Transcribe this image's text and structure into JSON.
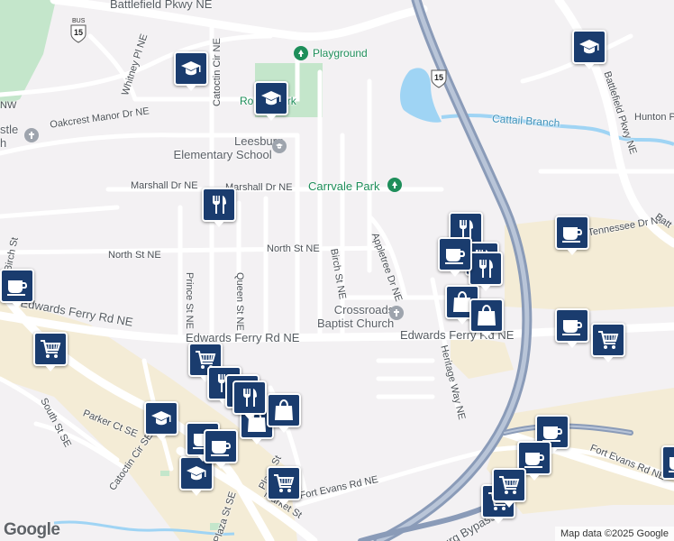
{
  "map": {
    "streets": {
      "battlefield_pkwy_top": "Battlefield Pkwy NE",
      "whitney": "Whitney Pl NE",
      "catoctin_top": "Catoctin Cir NE",
      "oakcrest": "Oakcrest Manor Dr NE",
      "marshall_left": "Marshall Dr NE",
      "marshall_right": "Marshall Dr NE",
      "north_left": "North St NE",
      "north_right": "North St NE",
      "birch": "Birch St NE",
      "appletree": "Appletree Dr NE",
      "prince": "Prince St NE",
      "queen": "Queen St NE",
      "edwards_left": "Edwards Ferry Rd NE",
      "edwards_center": "Edwards Ferry Rd NE",
      "edwards_right": "Edwards Ferry Rd NE",
      "heritage": "Heritage Way NE",
      "south": "South St SE",
      "parker": "Parker Ct SE",
      "catoctin_se": "Catoctin Cir SE",
      "plaza": "Plaza St",
      "plaza_se": "Plaza St SE",
      "market": "Market St",
      "fort_evans": "Fort Evans Rd NE",
      "fort_evans_right": "Fort Evans Rd NE",
      "bypass": "Leesburg Bypass",
      "battlefield_right": "Battlefield Pkwy NE",
      "hunton": "Hunton Pl NE",
      "tennessee": "Tennessee Dr NE",
      "nw": "NW",
      "battle_partial": "Batt",
      "birch_left": "Birch St"
    },
    "water": {
      "cattail": "Cattail Branch"
    },
    "places": {
      "playground": "Playground",
      "rouse_park": "Rouse Park",
      "leesburg_elem_line1": "Leesburg",
      "leesburg_elem_line2": "Elementary School",
      "carrvale": "Carrvale Park",
      "crossroads_line1": "Crossroads",
      "crossroads_line2": "Baptist Church",
      "castle_partial_line1": "stle",
      "castle_partial_line2": "h"
    },
    "shields": {
      "bus_label": "BUS",
      "bus_route": "15",
      "us_route": "15"
    },
    "pins": [
      {
        "type": "school-icon",
        "label": "school"
      },
      {
        "type": "school-icon",
        "label": "school"
      },
      {
        "type": "school-icon",
        "label": "school"
      },
      {
        "type": "school-icon",
        "label": "school"
      },
      {
        "type": "school-icon",
        "label": "school"
      },
      {
        "type": "restaurant-icon",
        "label": "restaurant"
      },
      {
        "type": "restaurant-icon",
        "label": "restaurant"
      },
      {
        "type": "restaurant-icon",
        "label": "restaurant"
      },
      {
        "type": "restaurant-icon",
        "label": "restaurant"
      },
      {
        "type": "cafe-icon",
        "label": "cafe"
      },
      {
        "type": "cafe-icon",
        "label": "cafe"
      },
      {
        "type": "cafe-icon",
        "label": "cafe"
      },
      {
        "type": "cafe-icon",
        "label": "cafe"
      },
      {
        "type": "cafe-icon",
        "label": "cafe"
      },
      {
        "type": "cafe-icon",
        "label": "cafe"
      },
      {
        "type": "shopping-bag-icon",
        "label": "store"
      },
      {
        "type": "shopping-bag-icon",
        "label": "store"
      },
      {
        "type": "shopping-bag-icon",
        "label": "store"
      },
      {
        "type": "shopping-bag-icon",
        "label": "store"
      },
      {
        "type": "shopping-cart-icon",
        "label": "grocery"
      },
      {
        "type": "shopping-cart-icon",
        "label": "grocery"
      },
      {
        "type": "shopping-cart-icon",
        "label": "grocery"
      },
      {
        "type": "shopping-cart-icon",
        "label": "grocery"
      },
      {
        "type": "shopping-cart-icon",
        "label": "grocery"
      },
      {
        "type": "shopping-cart-icon",
        "label": "grocery"
      }
    ],
    "colors": {
      "background": "#f3f1f3",
      "road": "#ffffff",
      "highway": "#8a9bb8",
      "water": "#9fd4f4",
      "park": "#c4e6cb",
      "commercial": "#f4ecd6",
      "pin": "#1a3c6e"
    }
  },
  "footer": {
    "logo": "Google",
    "attribution": "Map data ©2025 Google"
  }
}
